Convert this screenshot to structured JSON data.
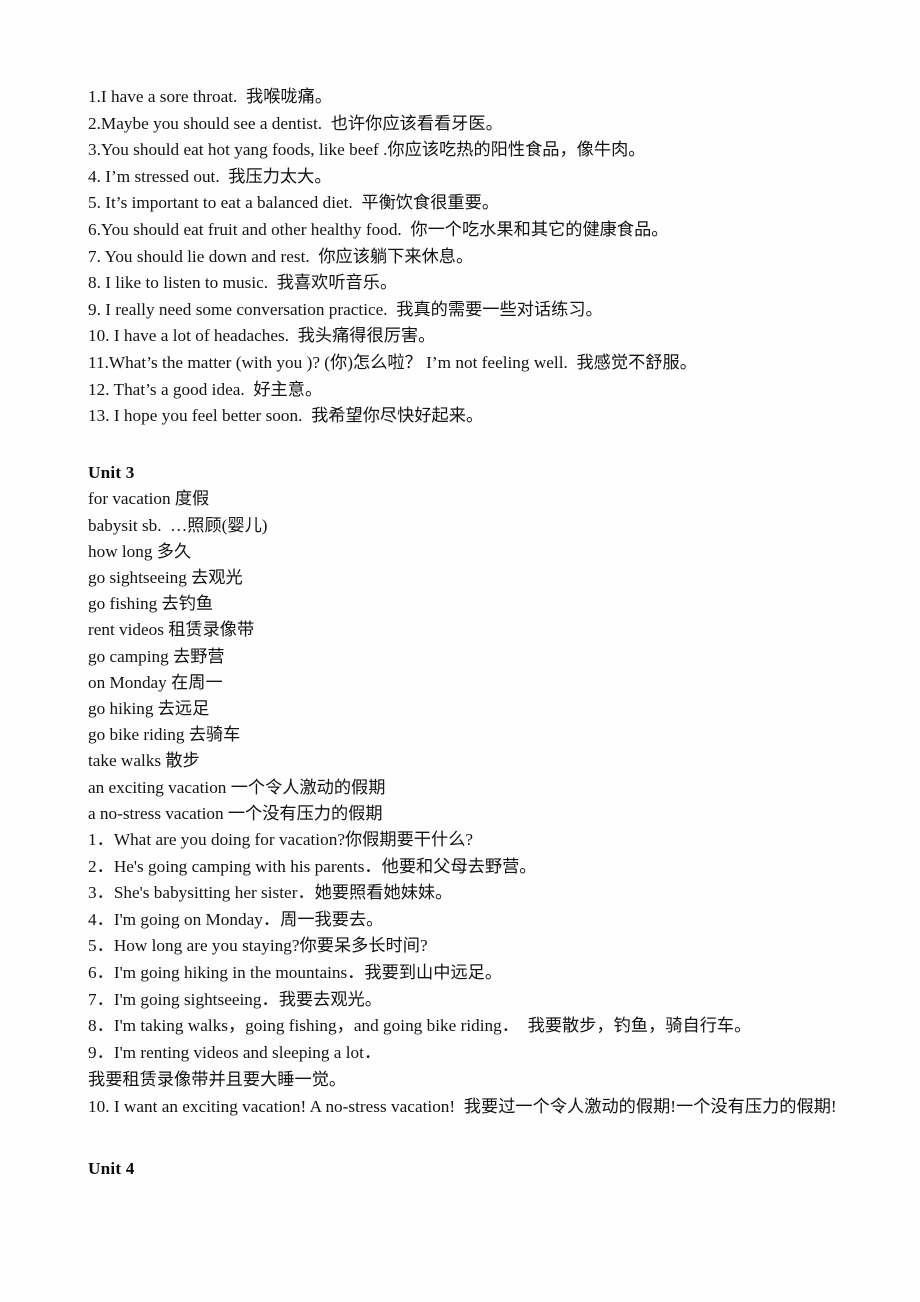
{
  "document": {
    "page_background": "#fefefe",
    "text_color": "#141414"
  },
  "unit2_sentences": [
    "1.I have a sore throat.  我喉咙痛。",
    "2.Maybe you should see a dentist.  也许你应该看看牙医。",
    "3.You should eat hot yang foods, like beef .你应该吃热的阳性食品，像牛肉。",
    "4. I’m stressed out.  我压力太大。",
    "5. It’s important to eat a balanced diet.  平衡饮食很重要。",
    "6.You should eat fruit and other healthy food.  你一个吃水果和其它的健康食品。",
    "7. You should lie down and rest.  你应该躺下来休息。",
    "8. I like to listen to music.  我喜欢听音乐。",
    "9. I really need some conversation practice.  我真的需要一些对话练习。",
    "10. I have a lot of headaches.  我头痛得很厉害。",
    "11.What’s the matter (with you )? (你)怎么啦？ I’m not feeling well.  我感觉不舒服。",
    "12. That’s a good idea.  好主意。",
    "13. I hope you feel better soon.  我希望你尽快好起来。"
  ],
  "unit3": {
    "heading": "Unit 3",
    "vocabulary": [
      "for vacation 度假",
      "babysit sb.  …照顾(婴儿)",
      "how long 多久",
      "go sightseeing 去观光",
      "go fishing 去钓鱼",
      "rent videos 租赁录像带",
      "go camping 去野营",
      "on Monday 在周一",
      "go hiking 去远足",
      "go bike riding 去骑车",
      "take walks 散步",
      "an exciting vacation 一个令人激动的假期",
      "a no-stress vacation 一个没有压力的假期"
    ],
    "sentences": [
      "1．What are you doing for vacation?你假期要干什么?",
      "2．He's going camping with his parents．他要和父母去野营。",
      "3．She's babysitting her sister．她要照看她妹妹。",
      "4．I'm going on Monday．周一我要去。",
      "5．How long are you staying?你要呆多长时间?",
      "6．I'm going hiking in the mountains．我要到山中远足。",
      "7．I'm going sightseeing．我要去观光。",
      "8．I'm taking walks，going fishing，and going bike riding．  我要散步，钓鱼，骑自行车。",
      "9．I'm renting videos and sleeping a lot．",
      "我要租赁录像带并且要大睡一觉。",
      "10. I want an exciting vacation! A no-stress vacation!  我要过一个令人激动的假期!一个没有压力的假期!"
    ]
  },
  "unit4": {
    "heading": "Unit 4"
  }
}
